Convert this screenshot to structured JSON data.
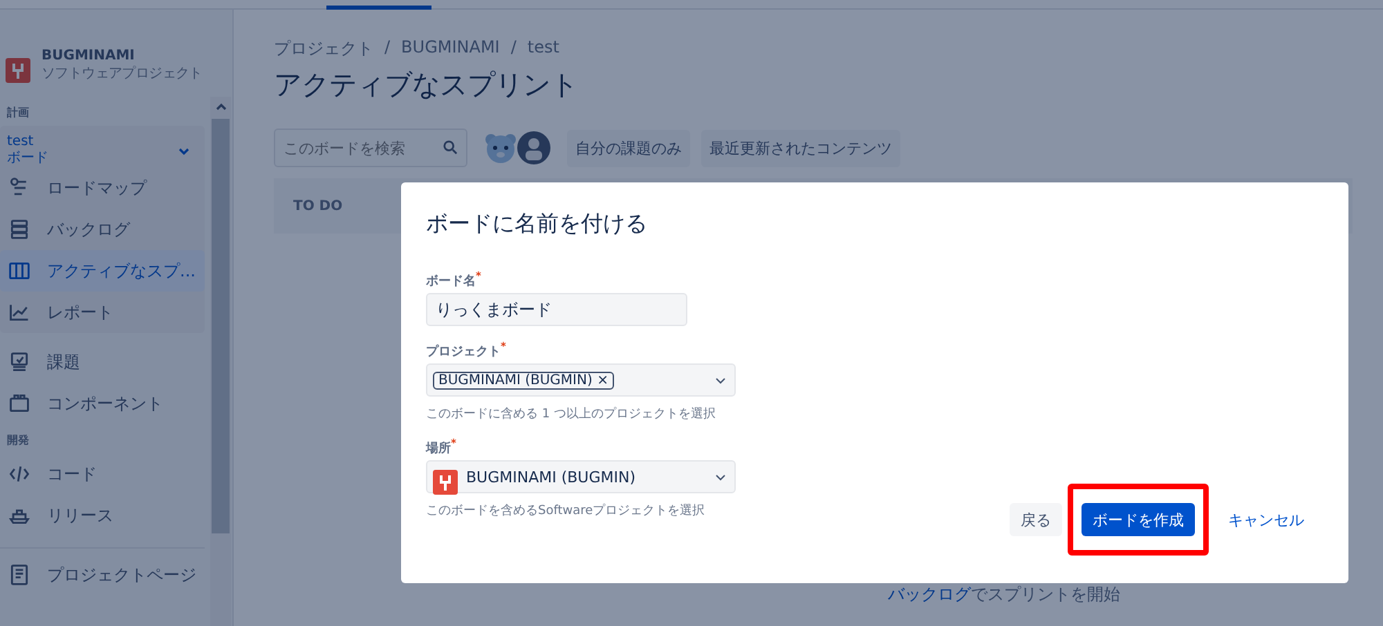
{
  "sidebar": {
    "project": {
      "name": "BUGMINAMI",
      "type": "ソフトウェアプロジェクト"
    },
    "planning_heading": "計画",
    "board_switcher": {
      "name": "test",
      "type": "ボード",
      "expanded": true
    },
    "board_items": [
      {
        "label": "ロードマップ",
        "kind": "roadmap",
        "selected": false
      },
      {
        "label": "バックログ",
        "kind": "backlog",
        "selected": false
      },
      {
        "label": "アクティブなスプ...",
        "kind": "board",
        "selected": true
      },
      {
        "label": "レポート",
        "kind": "reports",
        "selected": false
      }
    ],
    "planning_items": [
      {
        "label": "課題",
        "kind": "issues",
        "selected": false
      },
      {
        "label": "コンポーネント",
        "kind": "components",
        "selected": false
      }
    ],
    "dev_heading": "開発",
    "dev_items": [
      {
        "label": "コード",
        "kind": "code",
        "selected": false
      },
      {
        "label": "リリース",
        "kind": "release",
        "selected": false
      }
    ],
    "project_page": {
      "label": "プロジェクトページ",
      "kind": "page",
      "selected": false
    }
  },
  "main": {
    "breadcrumbs": [
      "プロジェクト",
      "BUGMINAMI",
      "test"
    ],
    "breadcrumb_separator": "/",
    "title": "アクティブなスプリント",
    "search": {
      "placeholder": "このボードを検索"
    },
    "quick_filters": [
      "自分の課題のみ",
      "最近更新されたコンテンツ"
    ],
    "column": "TO DO",
    "empty_hint": {
      "link": "バックログ",
      "text": "でスプリントを開始"
    }
  },
  "dialog": {
    "title": "ボードに名前を付ける",
    "required_mark": "*",
    "fields": [
      {
        "kind": "text",
        "label": "ボード名",
        "required": true,
        "value": "りっくまボード"
      },
      {
        "kind": "multiselect",
        "label": "プロジェクト",
        "required": true,
        "tags": [
          {
            "label": "BUGMINAMI (BUGMIN)",
            "remove": "×"
          }
        ],
        "help": "このボードに含める 1 つ以上のプロジェクトを選択"
      },
      {
        "kind": "select",
        "label": "場所",
        "required": true,
        "value": "BUGMINAMI (BUGMIN)",
        "help": "このボードを含めるSoftwareプロジェクトを選択"
      }
    ],
    "buttons": [
      {
        "label": "戻る",
        "kind": "subtle",
        "highlighted": false
      },
      {
        "label": "ボードを作成",
        "kind": "primary",
        "highlighted": true
      },
      {
        "label": "キャンセル",
        "kind": "link",
        "highlighted": false
      }
    ]
  }
}
